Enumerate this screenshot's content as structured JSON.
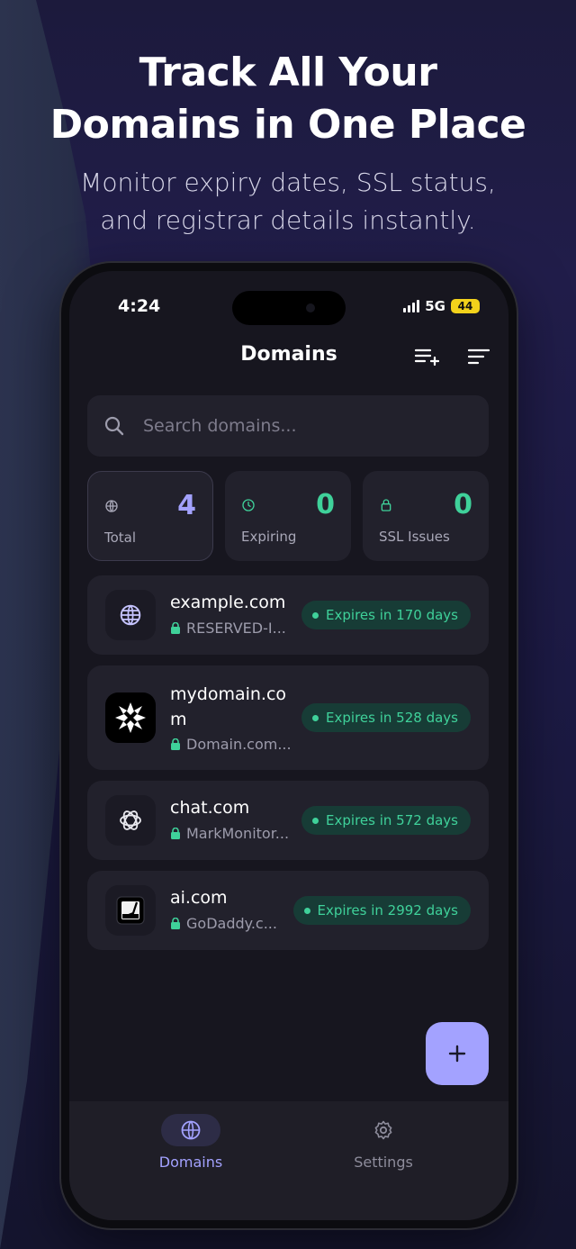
{
  "hero": {
    "title_line1": "Track All Your",
    "title_line2": "Domains in One Place",
    "subtitle": "Monitor expiry dates, SSL status, and registrar details instantly."
  },
  "status_bar": {
    "time": "4:24",
    "network": "5G",
    "battery": "44"
  },
  "header": {
    "title": "Domains",
    "add_list_icon": "playlist-add-icon",
    "sort_icon": "sort-icon"
  },
  "search": {
    "placeholder": "Search domains..."
  },
  "stats": [
    {
      "label": "Total",
      "value": "4",
      "icon": "globe-icon",
      "color": "#a3a2ff"
    },
    {
      "label": "Expiring",
      "value": "0",
      "icon": "clock-icon",
      "color": "#3fd19a"
    },
    {
      "label": "SSL Issues",
      "value": "0",
      "icon": "lock-icon",
      "color": "#3fd19a"
    }
  ],
  "domains": [
    {
      "name": "example.com",
      "registrar": "RESERVED-I...",
      "expiry": "Expires in 170 days",
      "logo": "globe-icon"
    },
    {
      "name_line1": "mydomain.co",
      "name_line2": "m",
      "registrar": "Domain.com...",
      "expiry": "Expires in 528 days",
      "logo": "domain-com-logo"
    },
    {
      "name": "chat.com",
      "registrar": "MarkMonitor...",
      "expiry": "Expires in 572 days",
      "logo": "openai-logo"
    },
    {
      "name": "ai.com",
      "registrar": "GoDaddy.c...",
      "expiry": "Expires in 2992 days",
      "logo": "ai-com-logo"
    }
  ],
  "fab": {
    "icon": "plus-icon"
  },
  "tabs": [
    {
      "label": "Domains",
      "icon": "globe-icon",
      "active": true
    },
    {
      "label": "Settings",
      "icon": "gear-icon",
      "active": false
    }
  ],
  "colors": {
    "accent": "#a3a2ff",
    "success": "#3fd19a",
    "badge_bg": "#173c36",
    "card_bg": "#22212c"
  }
}
